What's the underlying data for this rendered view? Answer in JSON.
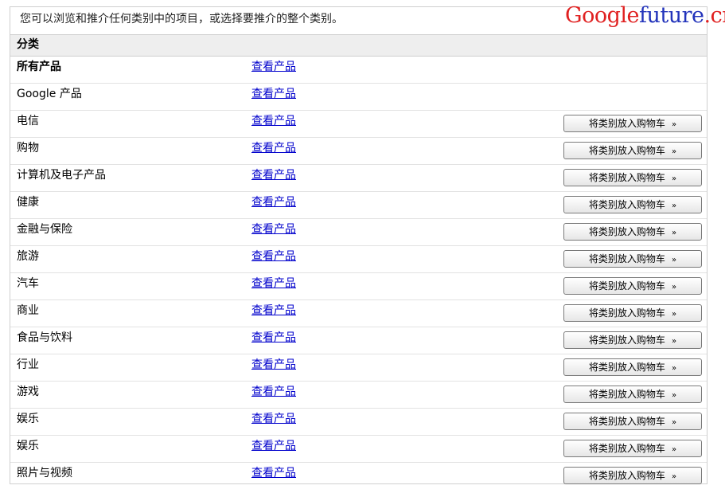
{
  "intro_text": "您可以浏览和推介任何类别中的项目，或选择要推介的整个类别。",
  "watermark": {
    "part1": "Google",
    "part2": "future",
    "part3": ".cn"
  },
  "table": {
    "header": "分类",
    "view_link_label": "查看产品",
    "add_button_label": "将类别放入购物车",
    "add_button_chevron": "»",
    "rows": [
      {
        "name": "所有产品",
        "bold": true,
        "has_button": false
      },
      {
        "name": "Google 产品",
        "bold": false,
        "has_button": false
      },
      {
        "name": "电信",
        "bold": false,
        "has_button": true
      },
      {
        "name": "购物",
        "bold": false,
        "has_button": true
      },
      {
        "name": "计算机及电子产品",
        "bold": false,
        "has_button": true
      },
      {
        "name": "健康",
        "bold": false,
        "has_button": true
      },
      {
        "name": "金融与保险",
        "bold": false,
        "has_button": true
      },
      {
        "name": "旅游",
        "bold": false,
        "has_button": true
      },
      {
        "name": "汽车",
        "bold": false,
        "has_button": true
      },
      {
        "name": "商业",
        "bold": false,
        "has_button": true
      },
      {
        "name": "食品与饮料",
        "bold": false,
        "has_button": true
      },
      {
        "name": "行业",
        "bold": false,
        "has_button": true
      },
      {
        "name": "游戏",
        "bold": false,
        "has_button": true
      },
      {
        "name": "娱乐",
        "bold": false,
        "has_button": true
      },
      {
        "name": "娱乐",
        "bold": false,
        "has_button": true
      },
      {
        "name": "照片与视频",
        "bold": false,
        "has_button": true
      }
    ]
  }
}
